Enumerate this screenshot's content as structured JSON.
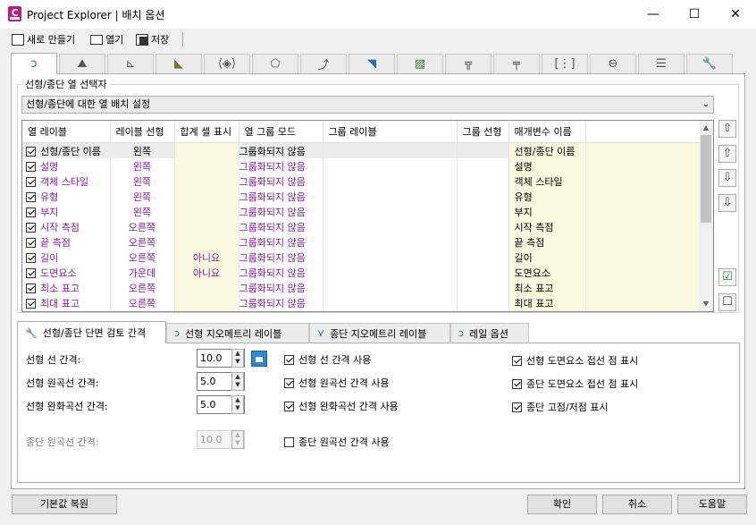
{
  "window": {
    "title": "Project Explorer | 배치 옵션",
    "app_icon_letter": "C",
    "minimize": "—",
    "maximize": "☐",
    "close": "✕"
  },
  "toolbar": {
    "new_label": "새로 만들기",
    "open_label": "열기",
    "save_label": "저장"
  },
  "top_tabs": [
    "alignment",
    "surfaces",
    "profiles",
    "corridors",
    "sample-lines",
    "point-groups",
    "feature-lines",
    "pipe-networks",
    "survey",
    "assemblies",
    "subassemblies",
    "profile-views",
    "section-views",
    "settings",
    "tools"
  ],
  "selector": {
    "group_title": "선형/종단 열 선택자",
    "combo_value": "선형/종단에 대한 열 배치 설정"
  },
  "table": {
    "headers": [
      "열 레이블",
      "레이블 선형",
      "합계 셀 표시",
      "열 그룹 모드",
      "그룹 레이블",
      "그룹 선형",
      "매개변수 이름"
    ],
    "rows": [
      {
        "label": "선형/종단 이름",
        "align": "왼쪽",
        "total": "",
        "mode": "그룹화되지 않음",
        "group_label": "",
        "group_align": "",
        "param": "선형/종단 이름"
      },
      {
        "label": "설명",
        "align": "왼쪽",
        "total": "",
        "mode": "그룹화되지 않음",
        "group_label": "",
        "group_align": "",
        "param": "설명"
      },
      {
        "label": "객체 스타일",
        "align": "왼쪽",
        "total": "",
        "mode": "그룹화되지 않음",
        "group_label": "",
        "group_align": "",
        "param": "객체 스타일"
      },
      {
        "label": "유형",
        "align": "왼쪽",
        "total": "",
        "mode": "그룹화되지 않음",
        "group_label": "",
        "group_align": "",
        "param": "유형"
      },
      {
        "label": "부지",
        "align": "왼쪽",
        "total": "",
        "mode": "그룹화되지 않음",
        "group_label": "",
        "group_align": "",
        "param": "부지"
      },
      {
        "label": "시작 측점",
        "align": "오른쪽",
        "total": "",
        "mode": "그룹화되지 않음",
        "group_label": "",
        "group_align": "",
        "param": "시작 측점"
      },
      {
        "label": "끝 측점",
        "align": "오른쪽",
        "total": "",
        "mode": "그룹화되지 않음",
        "group_label": "",
        "group_align": "",
        "param": "끝 측점"
      },
      {
        "label": "길이",
        "align": "오른쪽",
        "total": "아니요",
        "mode": "그룹화되지 않음",
        "group_label": "",
        "group_align": "",
        "param": "길이"
      },
      {
        "label": "도면요소",
        "align": "가운데",
        "total": "아니요",
        "mode": "그룹화되지 않음",
        "group_label": "",
        "group_align": "",
        "param": "도면요소"
      },
      {
        "label": "최소 표고",
        "align": "오른쪽",
        "total": "",
        "mode": "그룹화되지 않음",
        "group_label": "",
        "group_align": "",
        "param": "최소 표고"
      },
      {
        "label": "최대 표고",
        "align": "오른쪽",
        "total": "",
        "mode": "그룹화되지 않음",
        "group_label": "",
        "group_align": "",
        "param": "최대 표고"
      },
      {
        "label": "",
        "align": "",
        "total": "",
        "mode": "",
        "group_label": "",
        "group_align": "",
        "param": ""
      }
    ]
  },
  "lower_tabs": [
    "선형/종단 단면 검토 간격",
    "선형 지오메트리 레이블",
    "종단 지오메트리 레이블",
    "레일 옵션"
  ],
  "intervals": {
    "alignment_line_label": "선형 선 간격:",
    "alignment_line_value": "10.0",
    "alignment_curve_label": "선형 원곡선 간격:",
    "alignment_curve_value": "5.0",
    "alignment_spiral_label": "선형 완화곡선 간격:",
    "alignment_spiral_value": "5.0",
    "profile_curve_label": "종단 원곡선 간격:",
    "profile_curve_value": "10.0"
  },
  "checkboxes": {
    "use_line": {
      "label": "선형 선 간격 사용",
      "checked": true
    },
    "use_curve": {
      "label": "선형 원곡선 간격 사용",
      "checked": true
    },
    "use_spiral": {
      "label": "선형 완화곡선 간격 사용",
      "checked": true
    },
    "use_profile_curve": {
      "label": "종단 원곡선 간격 사용",
      "checked": false
    },
    "show_align_tangent": {
      "label": "선형 도면요소 접선 점 표시",
      "checked": true
    },
    "show_profile_tangent": {
      "label": "종단 도면요소 접선 점 표시",
      "checked": true
    },
    "show_high_low": {
      "label": "종단 고점/저점 표시",
      "checked": true
    }
  },
  "buttons": {
    "restore": "기본값 복원",
    "ok": "확인",
    "cancel": "취소",
    "help": "도움말"
  }
}
